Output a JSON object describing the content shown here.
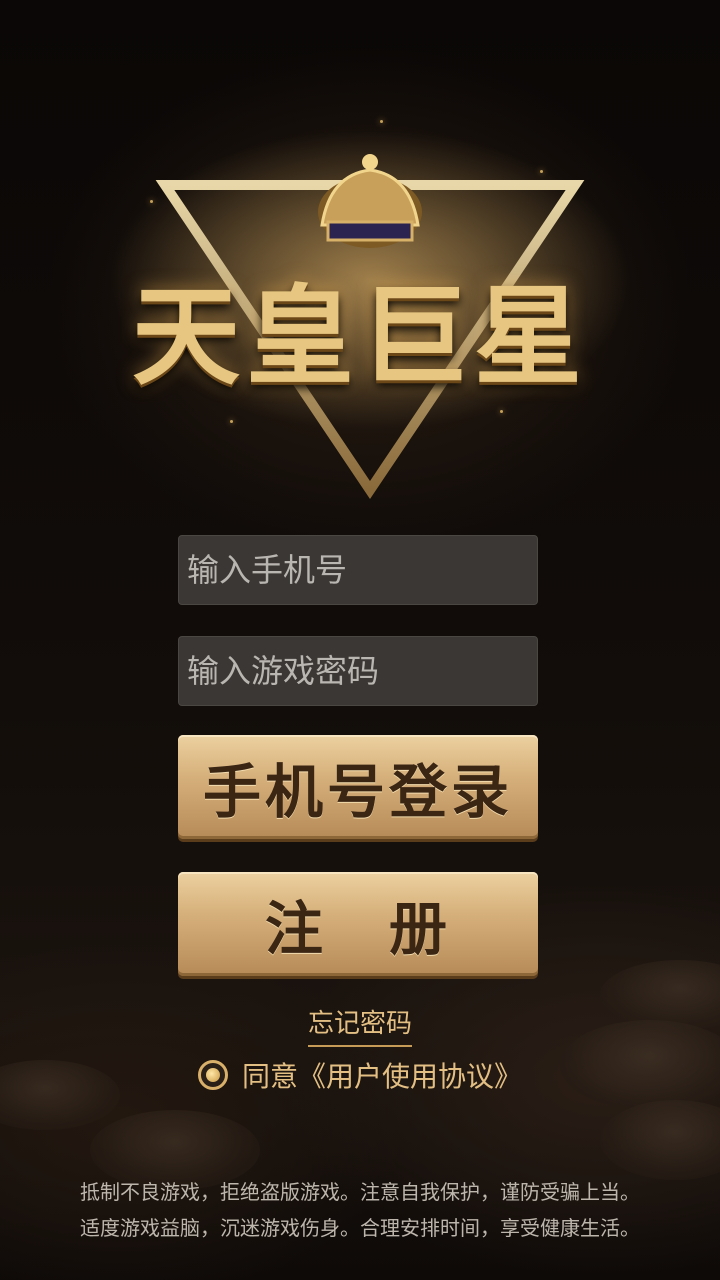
{
  "logo": {
    "title": "天皇巨星"
  },
  "login_form": {
    "phone_placeholder": "输入手机号",
    "password_placeholder": "输入游戏密码",
    "login_button": "手机号登录",
    "register_button": "注　册",
    "forgot_password": "忘记密码",
    "agreement": "同意《用户使用协议》",
    "agreement_checked": true
  },
  "notice": {
    "line1": "抵制不良游戏，拒绝盗版游戏。注意自我保护，谨防受骗上当。",
    "line2": "适度游戏益脑，沉迷游戏伤身。合理安排时间，享受健康生活。"
  },
  "colors": {
    "gold": "#d6b07b",
    "accent_text": "#e3bf84",
    "field_bg": "#3a3734"
  }
}
